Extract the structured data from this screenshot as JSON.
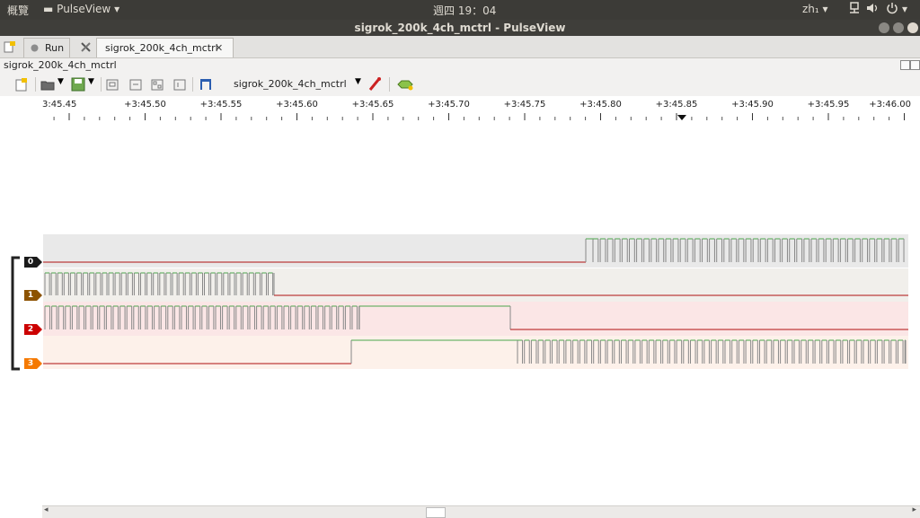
{
  "topbar": {
    "activities": "概覽",
    "app_menu": "PulseView",
    "clock": "週四 19：04",
    "lang": "zh₁"
  },
  "window": {
    "title": "sigrok_200k_4ch_mctrl - PulseView"
  },
  "tabs": [
    {
      "label": "Run"
    },
    {
      "label": "sigrok_200k_4ch_mctrl",
      "close": "✕"
    }
  ],
  "document": {
    "name": "sigrok_200k_4ch_mctrl"
  },
  "toolbar": {
    "device": "sigrok_200k_4ch_mctrl"
  },
  "ruler": {
    "labels": [
      "3:45.45",
      "+3:45.50",
      "+3:45.55",
      "+3:45.60",
      "+3:45.65",
      "+3:45.70",
      "+3:45.75",
      "+3:45.80",
      "+3:45.85",
      "+3:45.90",
      "+3:45.95",
      "+3:46.00"
    ],
    "cursor_marker": "+3:45.85"
  },
  "channels": [
    {
      "label": "0",
      "color": "#1a1a1a",
      "band": "#e9e9e9"
    },
    {
      "label": "1",
      "color": "#8c5200",
      "band": "#f1efeb"
    },
    {
      "label": "2",
      "color": "#cc0000",
      "band": "#fbe6e6"
    },
    {
      "label": "3",
      "color": "#f57900",
      "band": "#fdf1ea"
    }
  ],
  "colors": {
    "high": "#4ca64c",
    "low": "#b01010",
    "edge": "#888888"
  }
}
